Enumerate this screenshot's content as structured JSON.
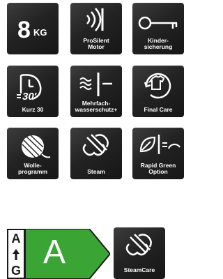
{
  "features": [
    {
      "id": "capacity",
      "value": "8",
      "unit": "KG",
      "icon": "capacity-icon"
    },
    {
      "id": "prosilent",
      "label": "ProSilent\nMotor",
      "icon": "sound-waves-icon"
    },
    {
      "id": "childlock",
      "label": "Kinder-\nsicherung",
      "icon": "key-icon"
    },
    {
      "id": "kurz30",
      "label": "Kurz 30",
      "clock_text": "30'",
      "icon": "timer-icon"
    },
    {
      "id": "mehrfach",
      "label": "Mehrfach-\nwasserschutz+",
      "icon": "water-protection-icon"
    },
    {
      "id": "finalcare",
      "label": "Final Care",
      "icon": "shirt-cycle-icon"
    },
    {
      "id": "wolle",
      "label": "Wolle-\nprogramm",
      "icon": "wool-ball-icon"
    },
    {
      "id": "steam",
      "label": "Steam",
      "icon": "steam-icon"
    },
    {
      "id": "rapidgreen",
      "label": "Rapid Green\nOption",
      "icon": "leaf-speed-icon"
    }
  ],
  "energy_label": {
    "scale_top": "A",
    "scale_bottom": "G",
    "class": "A",
    "color": "#3aa535"
  },
  "steamcare": {
    "label": "SteamCare",
    "icon": "steam-icon"
  }
}
